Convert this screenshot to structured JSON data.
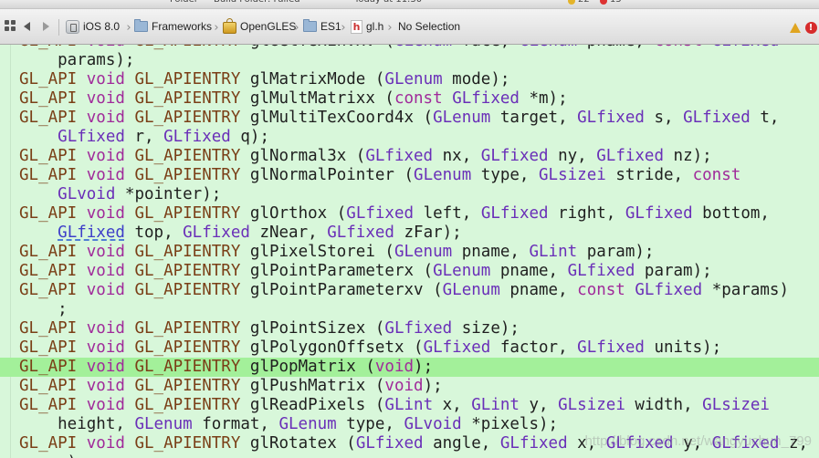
{
  "top_strip": {
    "folder_label": "Folder",
    "build_label": "Build Folder: Failed",
    "time_label": "Today at 11:30",
    "warning_count": "22",
    "error_count": "15"
  },
  "jump_bar": {
    "back_icon": "chevron-left-icon",
    "forward_icon": "chevron-right-icon",
    "items": [
      {
        "label": "iOS 8.0",
        "icon": "sdk-icon"
      },
      {
        "label": "Frameworks",
        "icon": "folder-icon"
      },
      {
        "label": "OpenGLES",
        "icon": "framework-icon"
      },
      {
        "label": "ES1",
        "icon": "folder-icon"
      },
      {
        "label": "gl.h",
        "icon": "header-file-icon"
      },
      {
        "label": "No Selection",
        "icon": ""
      }
    ]
  },
  "editor": {
    "highlight_color": "#a3f09a",
    "background_color": "#d8f7da",
    "lines": [
      [
        [
          "m",
          "GL_API"
        ],
        [
          "c",
          " "
        ],
        [
          "k",
          "void"
        ],
        [
          "c",
          " "
        ],
        [
          "m",
          "GL_APIENTRY"
        ],
        [
          "c",
          " glGetTexEnvxv ("
        ],
        [
          "t",
          "GLenum"
        ],
        [
          "c",
          " face, "
        ],
        [
          "t",
          "GLenum"
        ],
        [
          "c",
          " pname, "
        ],
        [
          "k",
          "const"
        ],
        [
          "c",
          " "
        ],
        [
          "t",
          "GLfixed"
        ],
        [
          "c",
          " *"
        ]
      ],
      [
        [
          "c",
          "    params);"
        ]
      ],
      [
        [
          "m",
          "GL_API"
        ],
        [
          "c",
          " "
        ],
        [
          "k",
          "void"
        ],
        [
          "c",
          " "
        ],
        [
          "m",
          "GL_APIENTRY"
        ],
        [
          "c",
          " glMatrixMode ("
        ],
        [
          "t",
          "GLenum"
        ],
        [
          "c",
          " mode);"
        ]
      ],
      [
        [
          "m",
          "GL_API"
        ],
        [
          "c",
          " "
        ],
        [
          "k",
          "void"
        ],
        [
          "c",
          " "
        ],
        [
          "m",
          "GL_APIENTRY"
        ],
        [
          "c",
          " glMultMatrixx ("
        ],
        [
          "k",
          "const"
        ],
        [
          "c",
          " "
        ],
        [
          "t",
          "GLfixed"
        ],
        [
          "c",
          " *m);"
        ]
      ],
      [
        [
          "m",
          "GL_API"
        ],
        [
          "c",
          " "
        ],
        [
          "k",
          "void"
        ],
        [
          "c",
          " "
        ],
        [
          "m",
          "GL_APIENTRY"
        ],
        [
          "c",
          " glMultiTexCoord4x ("
        ],
        [
          "t",
          "GLenum"
        ],
        [
          "c",
          " target, "
        ],
        [
          "t",
          "GLfixed"
        ],
        [
          "c",
          " s, "
        ],
        [
          "t",
          "GLfixed"
        ],
        [
          "c",
          " t,"
        ]
      ],
      [
        [
          "c",
          "    "
        ],
        [
          "t",
          "GLfixed"
        ],
        [
          "c",
          " r, "
        ],
        [
          "t",
          "GLfixed"
        ],
        [
          "c",
          " q);"
        ]
      ],
      [
        [
          "m",
          "GL_API"
        ],
        [
          "c",
          " "
        ],
        [
          "k",
          "void"
        ],
        [
          "c",
          " "
        ],
        [
          "m",
          "GL_APIENTRY"
        ],
        [
          "c",
          " glNormal3x ("
        ],
        [
          "t",
          "GLfixed"
        ],
        [
          "c",
          " nx, "
        ],
        [
          "t",
          "GLfixed"
        ],
        [
          "c",
          " ny, "
        ],
        [
          "t",
          "GLfixed"
        ],
        [
          "c",
          " nz);"
        ]
      ],
      [
        [
          "m",
          "GL_API"
        ],
        [
          "c",
          " "
        ],
        [
          "k",
          "void"
        ],
        [
          "c",
          " "
        ],
        [
          "m",
          "GL_APIENTRY"
        ],
        [
          "c",
          " glNormalPointer ("
        ],
        [
          "t",
          "GLenum"
        ],
        [
          "c",
          " type, "
        ],
        [
          "t",
          "GLsizei"
        ],
        [
          "c",
          " stride, "
        ],
        [
          "k",
          "const"
        ]
      ],
      [
        [
          "c",
          "    "
        ],
        [
          "t",
          "GLvoid"
        ],
        [
          "c",
          " *pointer);"
        ]
      ],
      [
        [
          "m",
          "GL_API"
        ],
        [
          "c",
          " "
        ],
        [
          "k",
          "void"
        ],
        [
          "c",
          " "
        ],
        [
          "m",
          "GL_APIENTRY"
        ],
        [
          "c",
          " glOrthox ("
        ],
        [
          "t",
          "GLfixed"
        ],
        [
          "c",
          " left, "
        ],
        [
          "t",
          "GLfixed"
        ],
        [
          "c",
          " right, "
        ],
        [
          "t",
          "GLfixed"
        ],
        [
          "c",
          " bottom,"
        ]
      ],
      [
        [
          "c",
          "    "
        ],
        [
          "u",
          "GLfixed"
        ],
        [
          "c",
          " top, "
        ],
        [
          "t",
          "GLfixed"
        ],
        [
          "c",
          " zNear, "
        ],
        [
          "t",
          "GLfixed"
        ],
        [
          "c",
          " zFar);"
        ]
      ],
      [
        [
          "m",
          "GL_API"
        ],
        [
          "c",
          " "
        ],
        [
          "k",
          "void"
        ],
        [
          "c",
          " "
        ],
        [
          "m",
          "GL_APIENTRY"
        ],
        [
          "c",
          " glPixelStorei ("
        ],
        [
          "t",
          "GLenum"
        ],
        [
          "c",
          " pname, "
        ],
        [
          "t",
          "GLint"
        ],
        [
          "c",
          " param);"
        ]
      ],
      [
        [
          "m",
          "GL_API"
        ],
        [
          "c",
          " "
        ],
        [
          "k",
          "void"
        ],
        [
          "c",
          " "
        ],
        [
          "m",
          "GL_APIENTRY"
        ],
        [
          "c",
          " glPointParameterx ("
        ],
        [
          "t",
          "GLenum"
        ],
        [
          "c",
          " pname, "
        ],
        [
          "t",
          "GLfixed"
        ],
        [
          "c",
          " param);"
        ]
      ],
      [
        [
          "m",
          "GL_API"
        ],
        [
          "c",
          " "
        ],
        [
          "k",
          "void"
        ],
        [
          "c",
          " "
        ],
        [
          "m",
          "GL_APIENTRY"
        ],
        [
          "c",
          " glPointParameterxv ("
        ],
        [
          "t",
          "GLenum"
        ],
        [
          "c",
          " pname, "
        ],
        [
          "k",
          "const"
        ],
        [
          "c",
          " "
        ],
        [
          "t",
          "GLfixed"
        ],
        [
          "c",
          " *params)"
        ]
      ],
      [
        [
          "c",
          "    ;"
        ]
      ],
      [
        [
          "m",
          "GL_API"
        ],
        [
          "c",
          " "
        ],
        [
          "k",
          "void"
        ],
        [
          "c",
          " "
        ],
        [
          "m",
          "GL_APIENTRY"
        ],
        [
          "c",
          " glPointSizex ("
        ],
        [
          "t",
          "GLfixed"
        ],
        [
          "c",
          " size);"
        ]
      ],
      [
        [
          "m",
          "GL_API"
        ],
        [
          "c",
          " "
        ],
        [
          "k",
          "void"
        ],
        [
          "c",
          " "
        ],
        [
          "m",
          "GL_APIENTRY"
        ],
        [
          "c",
          " glPolygonOffsetx ("
        ],
        [
          "t",
          "GLfixed"
        ],
        [
          "c",
          " factor, "
        ],
        [
          "t",
          "GLfixed"
        ],
        [
          "c",
          " units);"
        ]
      ],
      [
        [
          "m",
          "GL_API"
        ],
        [
          "c",
          " "
        ],
        [
          "k",
          "void"
        ],
        [
          "c",
          " "
        ],
        [
          "m",
          "GL_APIENTRY"
        ],
        [
          "c",
          " glPopMatrix ("
        ],
        [
          "k",
          "void"
        ],
        [
          "c",
          ");"
        ]
      ],
      [
        [
          "m",
          "GL_API"
        ],
        [
          "c",
          " "
        ],
        [
          "k",
          "void"
        ],
        [
          "c",
          " "
        ],
        [
          "m",
          "GL_APIENTRY"
        ],
        [
          "c",
          " glPushMatrix ("
        ],
        [
          "k",
          "void"
        ],
        [
          "c",
          ");"
        ]
      ],
      [
        [
          "m",
          "GL_API"
        ],
        [
          "c",
          " "
        ],
        [
          "k",
          "void"
        ],
        [
          "c",
          " "
        ],
        [
          "m",
          "GL_APIENTRY"
        ],
        [
          "c",
          " glReadPixels ("
        ],
        [
          "t",
          "GLint"
        ],
        [
          "c",
          " x, "
        ],
        [
          "t",
          "GLint"
        ],
        [
          "c",
          " y, "
        ],
        [
          "t",
          "GLsizei"
        ],
        [
          "c",
          " width, "
        ],
        [
          "t",
          "GLsizei"
        ]
      ],
      [
        [
          "c",
          "    height, "
        ],
        [
          "t",
          "GLenum"
        ],
        [
          "c",
          " format, "
        ],
        [
          "t",
          "GLenum"
        ],
        [
          "c",
          " type, "
        ],
        [
          "t",
          "GLvoid"
        ],
        [
          "c",
          " *pixels);"
        ]
      ],
      [
        [
          "m",
          "GL_API"
        ],
        [
          "c",
          " "
        ],
        [
          "k",
          "void"
        ],
        [
          "c",
          " "
        ],
        [
          "m",
          "GL_APIENTRY"
        ],
        [
          "c",
          " glRotatex ("
        ],
        [
          "t",
          "GLfixed"
        ],
        [
          "c",
          " angle, "
        ],
        [
          "t",
          "GLfixed"
        ],
        [
          "c",
          " x, "
        ],
        [
          "t",
          "GLfixed"
        ],
        [
          "c",
          " y, "
        ],
        [
          "t",
          "GLfixed"
        ],
        [
          "c",
          " z,"
        ]
      ],
      [
        [
          "c",
          "    z);"
        ]
      ]
    ],
    "highlighted_line": 17,
    "watermark": "http://blog.csdn.net/wangyuchun_799"
  }
}
